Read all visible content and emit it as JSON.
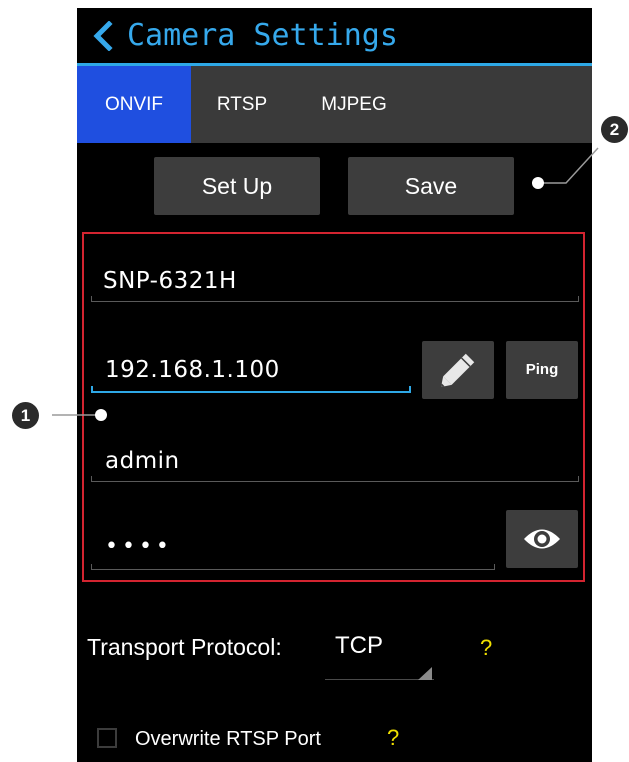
{
  "header": {
    "title": "Camera Settings",
    "back_icon": "chevron-left-icon",
    "accent_color": "#36a9ec"
  },
  "tabs": [
    {
      "label": "ONVIF",
      "active": true
    },
    {
      "label": "RTSP",
      "active": false
    },
    {
      "label": "MJPEG",
      "active": false
    }
  ],
  "actions": {
    "setup_label": "Set Up",
    "save_label": "Save"
  },
  "form": {
    "camera_name": "SNP-6321H",
    "ip_address": "192.168.1.100",
    "edit_icon": "pencil-icon",
    "ping_label": "Ping",
    "username": "admin",
    "password_masked": "••••",
    "show_password_icon": "eye-icon",
    "highlight_color": "#d32430"
  },
  "transport": {
    "label": "Transport Protocol:",
    "value": "TCP",
    "help": "?"
  },
  "rtsp_port": {
    "label": "Overwrite RTSP Port",
    "checked": false,
    "help": "?"
  },
  "callouts": {
    "one": "1",
    "two": "2"
  },
  "colors": {
    "active_tab": "#1f4fe0",
    "help": "#f0e000",
    "background": "#000000"
  }
}
